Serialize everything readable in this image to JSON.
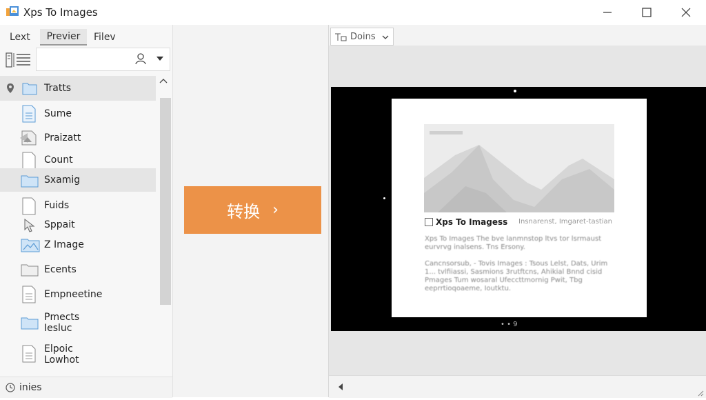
{
  "window": {
    "title": "Xps To Images"
  },
  "left_panel": {
    "tabs": [
      {
        "label": "Lext"
      },
      {
        "label": "Previer"
      },
      {
        "label": "Filev"
      }
    ],
    "list_items": [
      {
        "label": "Tratts",
        "icon": "folder-icon",
        "selected": true
      },
      {
        "label": "Sume",
        "icon": "document-icon"
      },
      {
        "label": "Praizatt",
        "icon": "image-file-icon"
      },
      {
        "label": "Count",
        "icon": "document-icon"
      },
      {
        "label": "Sxamig",
        "icon": "folder-icon",
        "selected": true
      },
      {
        "label": "Fuids",
        "icon": "document-icon"
      },
      {
        "label": "Sppait",
        "icon": "cursor-icon"
      },
      {
        "label": "Z Image",
        "icon": "image-folder-icon"
      },
      {
        "label": "Ecents",
        "icon": "folder-icon"
      },
      {
        "label": "Empneetine",
        "icon": "document-icon"
      },
      {
        "label": "Pmects\nIesluc",
        "icon": "folder-icon"
      },
      {
        "label": "Elpoic\nLowhot",
        "icon": "document-icon"
      }
    ],
    "status_text": "inies"
  },
  "convert": {
    "label": "转换",
    "chevron": "›",
    "color": "#ec9248"
  },
  "preview": {
    "zoom_label": "Doins",
    "page": {
      "heading": "Xps To Imagess",
      "heading_sub": "Insnarenst, Imgaret-tastian",
      "para1": "Xps To Images The bve lanmnstop ltvs tor lsrmaust eurvrvg inalsens. Tns Ersony.",
      "para2": "Cancnsorsub, - Tovis Images : Tsous Lelst, Dats, Urim 1... tvlfiiassi, Sasmions 3rutftcns, Ahikial Bnnd cisid Pmages Tum wosaral Ufeccttmornig Pwit, Tbg eeprrtioqoaeme, Ioutktu."
    },
    "pager": "• • 9"
  }
}
